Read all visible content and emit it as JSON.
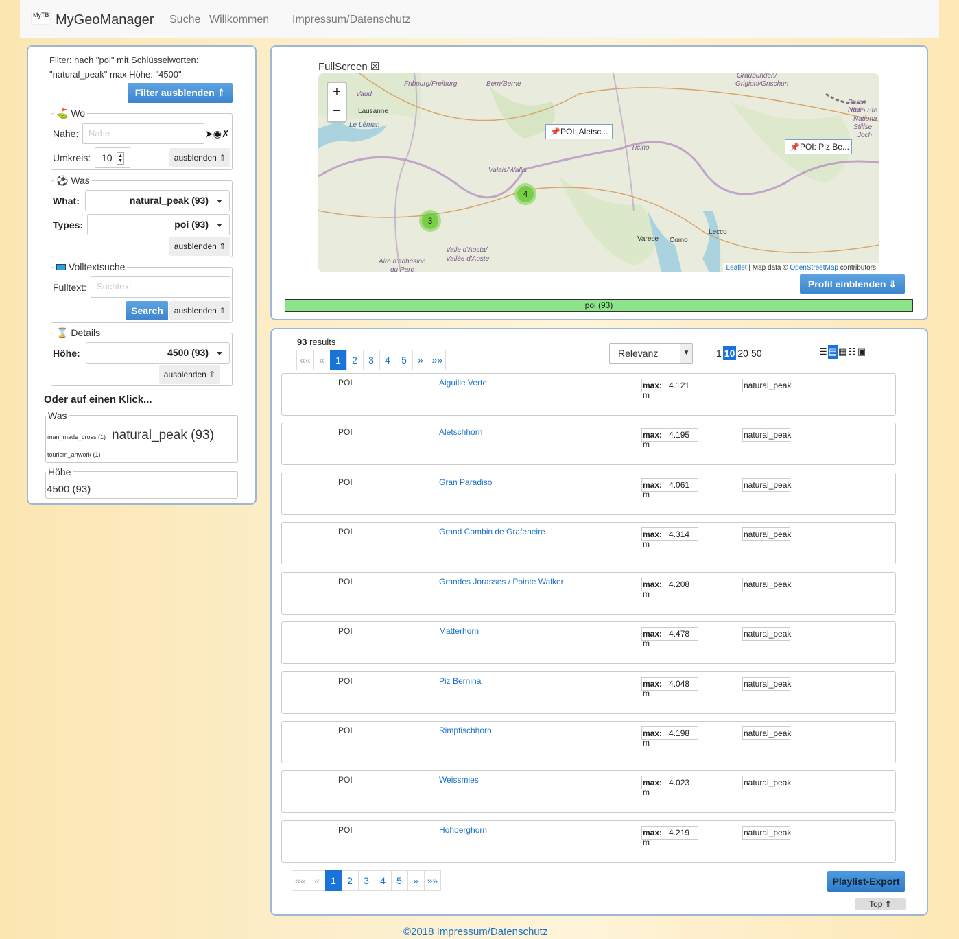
{
  "nav": {
    "logo": "MyTB",
    "brand": "MyGeoManager",
    "items": [
      "Suche",
      "Willkommen",
      "Impressum/Datenschutz"
    ]
  },
  "filter": {
    "summary_line1": "Filter: nach \"poi\" mit Schlüsselworten:",
    "summary_line2": "\"natural_peak\" max Höhe: \"4500\"",
    "hide_button": "Filter ausblenden ⇑",
    "wo": {
      "legend": "Wo",
      "near_label": "Nahe:",
      "near_placeholder": "Nahe",
      "near_icons": "➤◉✗",
      "radius_label": "Umkreis:",
      "radius_value": "10",
      "hide": "ausblenden ⇑"
    },
    "was": {
      "legend": "Was",
      "what_label": "What:",
      "what_value": "natural_peak (93)",
      "types_label": "Types:",
      "types_value": "poi (93)",
      "hide": "ausblenden ⇑"
    },
    "fulltext": {
      "legend": "Volltextsuche",
      "label": "Fulltext:",
      "placeholder": "Suchtext",
      "search_button": "Search",
      "hide": "ausblenden ⇑"
    },
    "details": {
      "legend": "Details",
      "height_label": "Höhe:",
      "height_value": "4500 (93)",
      "hide": "ausblenden ⇑"
    },
    "oneclick": {
      "title": "Oder auf einen Klick...",
      "was_legend": "Was",
      "tag1": "man_made_cross (1)",
      "tag2": "natural_peak (93)",
      "tag3": "tourism_artwork (1)",
      "hoehe_legend": "Höhe",
      "hoehe_tag": "4500 (93)"
    }
  },
  "map": {
    "fullscreen": "FullScreen ☒",
    "zoom_in": "+",
    "zoom_out": "−",
    "labels": [
      "Vaud",
      "Fribourg/Freiburg",
      "Bern/Berne",
      "Graubünden/",
      "Grigioni/Grischun",
      "Lausanne",
      "Le Léman",
      "Ticino",
      "Valais/Wallis",
      "Valle d'Aosta/",
      "Vallée d'Aoste",
      "Aire d'adhésion",
      "du Parc",
      "Parco Naz",
      "dello Ste",
      "Nationa",
      "Stilfse",
      "Joch"
    ],
    "towns": [
      "Varese",
      "Como",
      "Lecco"
    ],
    "popup1": "📌POI: Aletsc...",
    "popup2": "📌POI: Piz Be...",
    "cluster1": "4",
    "cluster2": "3",
    "attrib_leaflet": "Leaflet",
    "attrib_mid": " | Map data © ",
    "attrib_osm": "OpenStreetMap",
    "attrib_end": " contributors",
    "profile_button": "Profil einblenden ⇓",
    "progress_label": "poi (93)",
    "progress_fraction": 1.0
  },
  "results": {
    "count": "93",
    "count_label": " results",
    "pagination": [
      "««",
      "«",
      "1",
      "2",
      "3",
      "4",
      "5",
      "»",
      "»»"
    ],
    "sort_value": "Relevanz",
    "perpage": [
      "1",
      "10",
      "20",
      "50"
    ],
    "view_icons": [
      "☰",
      "▤",
      "▦",
      "☷",
      "▣"
    ],
    "items": [
      {
        "type": "POI",
        "name": "Aiguille Verte",
        "dot": ".",
        "max_label": "max:",
        "max": "4.121 m",
        "kw": "natural_peak"
      },
      {
        "type": "POI",
        "name": "Aletschhorn",
        "dot": ".",
        "max_label": "max:",
        "max": "4.195 m",
        "kw": "natural_peak"
      },
      {
        "type": "POI",
        "name": "Gran Paradiso",
        "dot": ".",
        "max_label": "max:",
        "max": "4.061 m",
        "kw": "natural_peak"
      },
      {
        "type": "POI",
        "name": "Grand Combin de Grafeneire",
        "dot": ".",
        "max_label": "max:",
        "max": "4.314 m",
        "kw": "natural_peak"
      },
      {
        "type": "POI",
        "name": "Grandes Jorasses / Pointe Walker",
        "dot": ".",
        "max_label": "max:",
        "max": "4.208 m",
        "kw": "natural_peak"
      },
      {
        "type": "POI",
        "name": "Matterhorn",
        "dot": ".",
        "max_label": "max:",
        "max": "4.478 m",
        "kw": "natural_peak"
      },
      {
        "type": "POI",
        "name": "Piz Bernina",
        "dot": ".",
        "max_label": "max:",
        "max": "4.048 m",
        "kw": "natural_peak"
      },
      {
        "type": "POI",
        "name": "Rimpfischhorn",
        "dot": ".",
        "max_label": "max:",
        "max": "4.198 m",
        "kw": "natural_peak"
      },
      {
        "type": "POI",
        "name": "Weissmies",
        "dot": ".",
        "max_label": "max:",
        "max": "4.023 m",
        "kw": "natural_peak"
      },
      {
        "type": "POI",
        "name": "Hohberghorn",
        "dot": ".",
        "max_label": "max:",
        "max": "4.219 m",
        "kw": "natural_peak"
      }
    ],
    "playlist_button": "Playlist-Export",
    "top_button": "Top ⇑"
  },
  "footer": "©2018 Impressum/Datenschutz",
  "colors": {
    "accent": "#1a73d8",
    "progress": "#8de38a",
    "panel_border": "#9fb6d6"
  }
}
